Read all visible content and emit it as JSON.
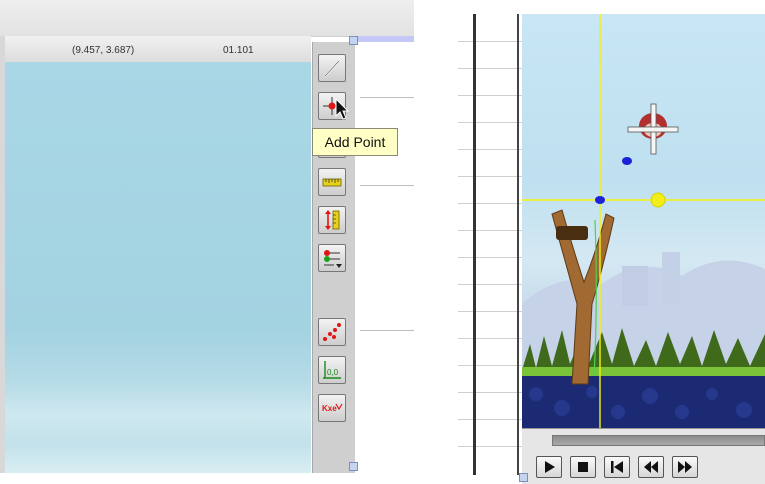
{
  "coordinate_readout": {
    "position": "(9.457, 3.687)",
    "value": "01.101"
  },
  "tooltip": {
    "text": "Add Point"
  },
  "toolbar": {
    "tools": [
      {
        "name": "line-tool",
        "icon": "diagonal-line-icon"
      },
      {
        "name": "add-point-tool",
        "icon": "add-point-icon"
      },
      {
        "name": "hidden-tool",
        "icon": "unknown-icon"
      },
      {
        "name": "ruler-tool",
        "icon": "ruler-icon"
      },
      {
        "name": "scale-tool",
        "icon": "vertical-scale-icon"
      },
      {
        "name": "series-options-tool",
        "icon": "series-options-icon"
      },
      {
        "name": "scatter-tool",
        "icon": "scatter-points-icon"
      },
      {
        "name": "axis-origin-tool",
        "icon": "axis-origin-icon"
      },
      {
        "name": "fit-tool",
        "icon": "fit-curve-icon"
      }
    ],
    "origin_label": "0,0",
    "fit_label": "Kxe"
  },
  "player": {
    "buttons": [
      {
        "name": "play-button",
        "icon": "play-icon"
      },
      {
        "name": "stop-button",
        "icon": "stop-icon"
      },
      {
        "name": "go-to-start-button",
        "icon": "skip-to-start-icon"
      },
      {
        "name": "step-back-button",
        "icon": "rewind-icon"
      },
      {
        "name": "step-forward-button",
        "icon": "fast-forward-icon"
      }
    ]
  },
  "colors": {
    "crosshair": "#f6f20a",
    "marker_blue": "#1a22d8",
    "marker_yellow": "#f3ee1a",
    "tooltip_bg": "#ffffc6",
    "sky": "#a9d7e6"
  }
}
